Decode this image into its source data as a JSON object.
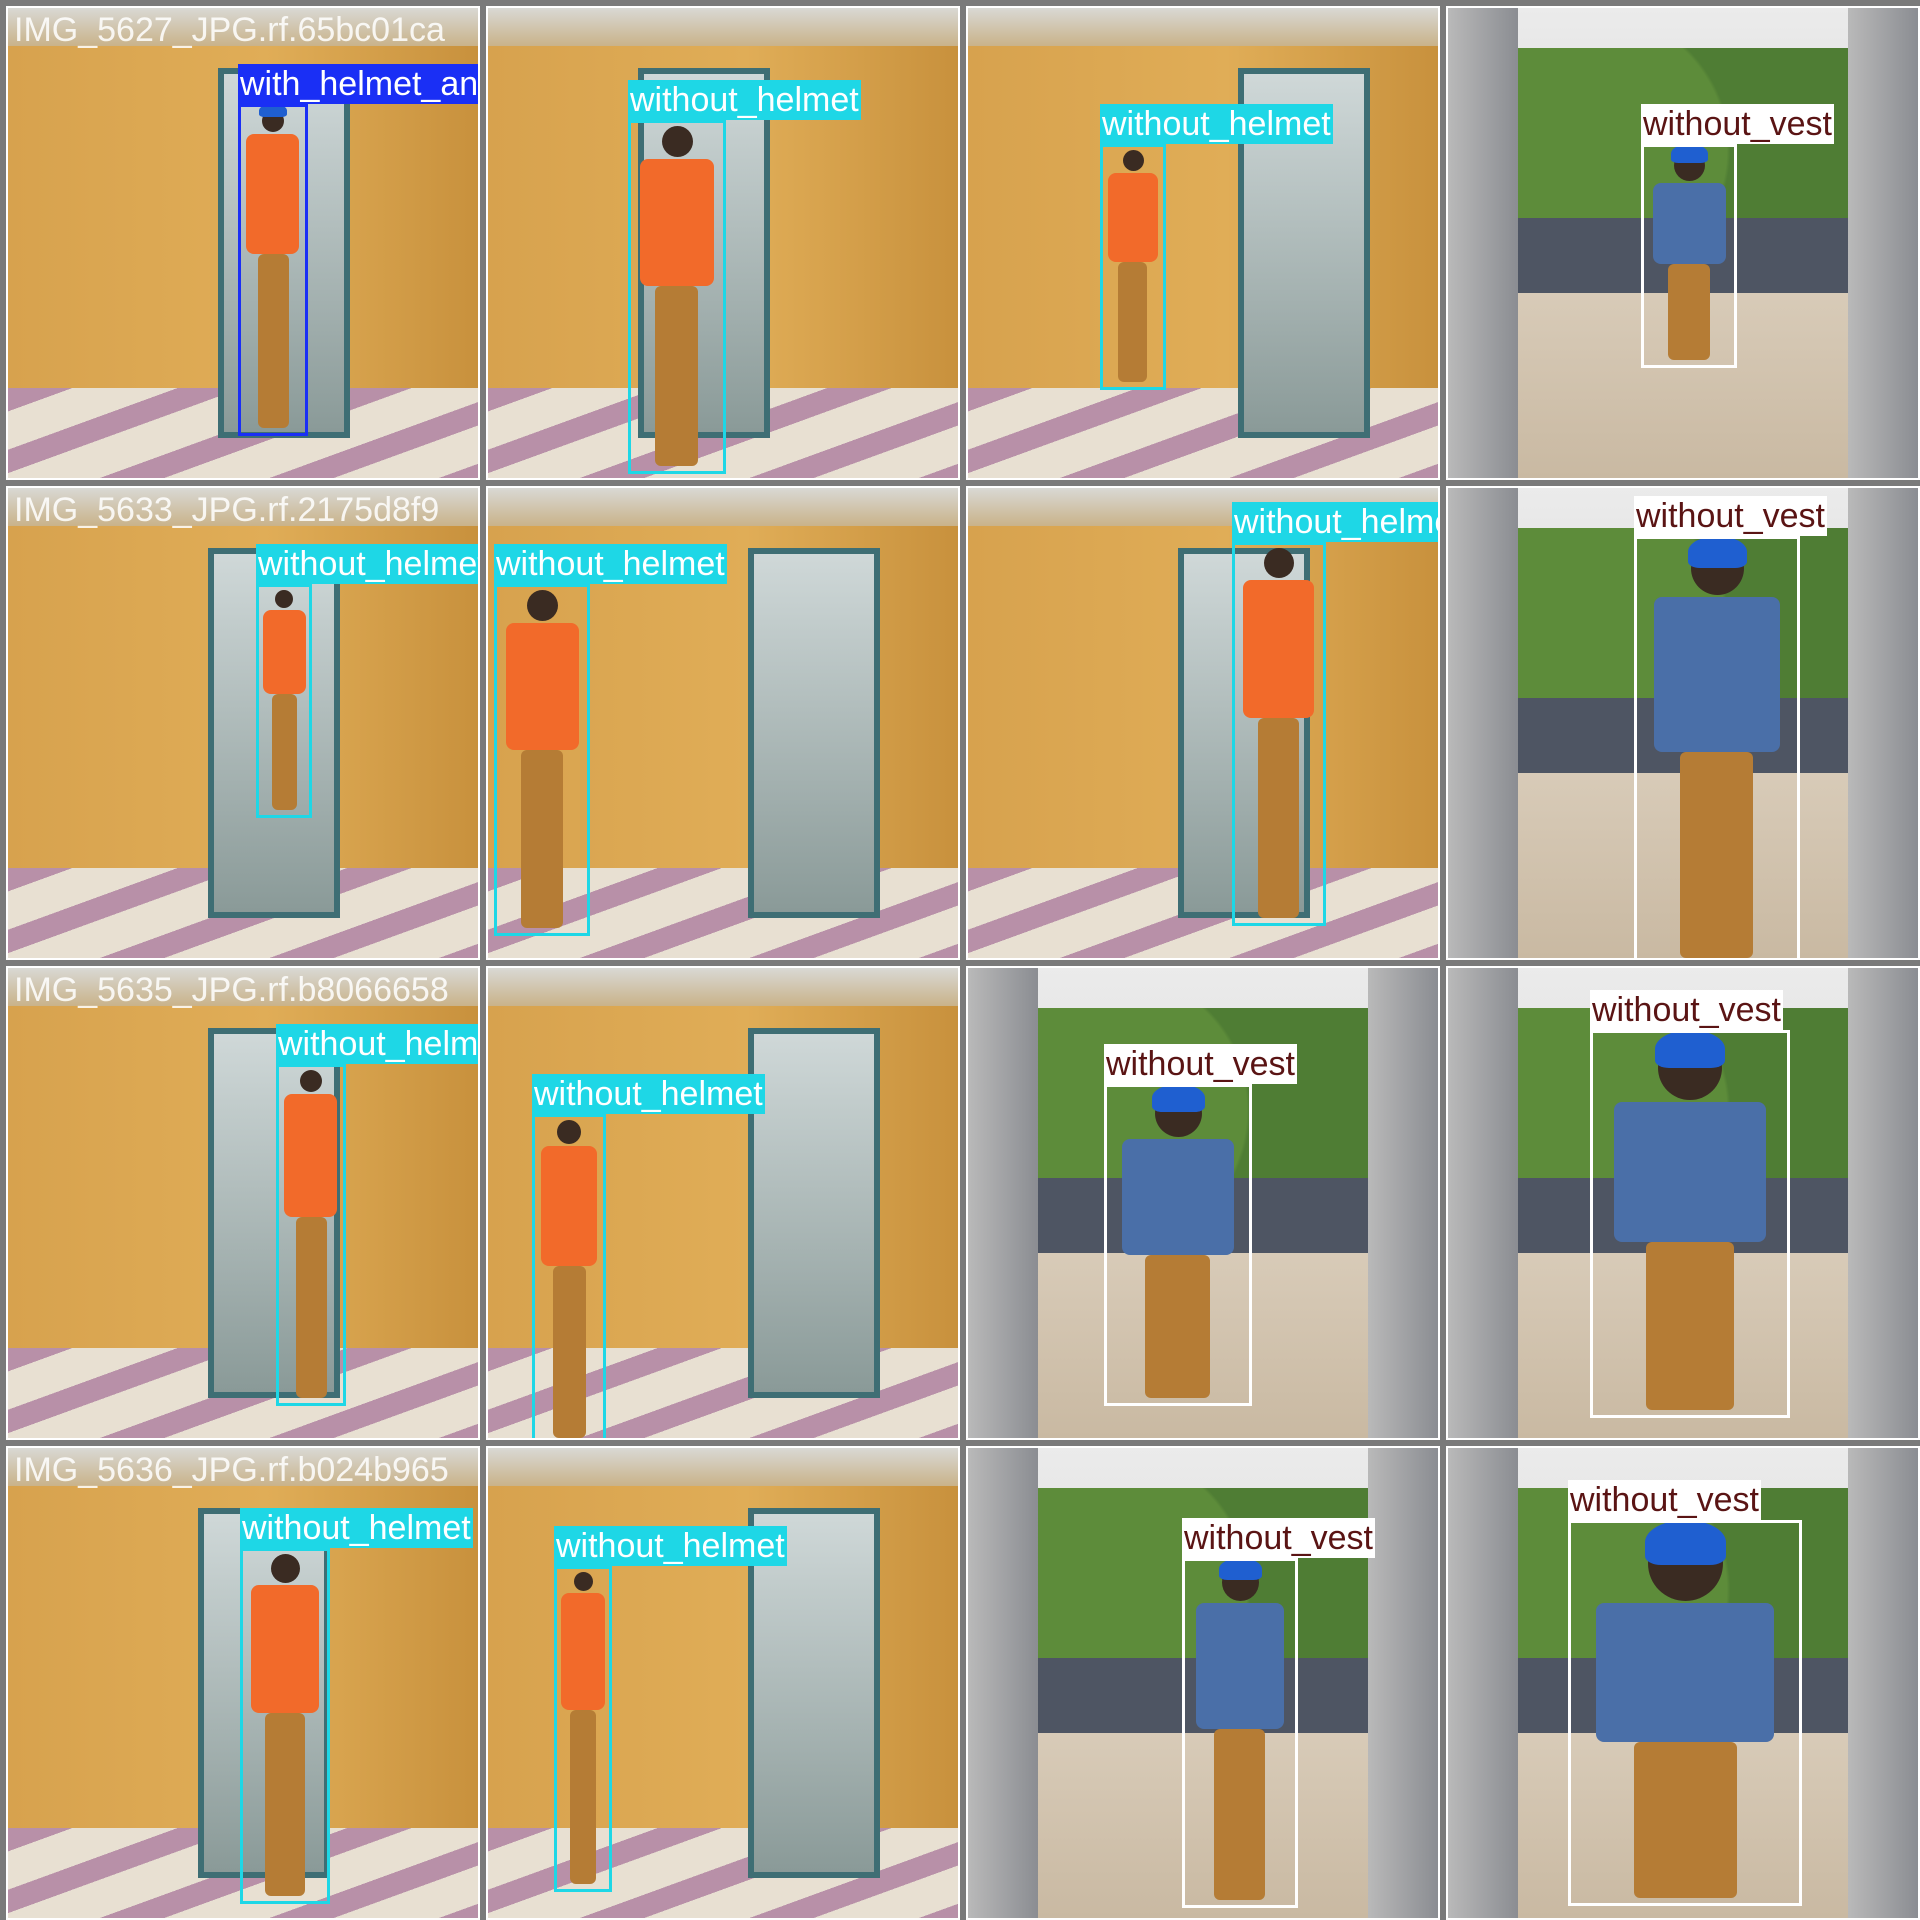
{
  "classes": {
    "with_helmet_and_vest": {
      "label": "with_helmet_and_vest",
      "color": "#1a2ff5",
      "text_color": "#ffffff"
    },
    "without_helmet": {
      "label": "without_helmet",
      "color": "#1ed7e6",
      "text_color": "#ffffff"
    },
    "without_vest": {
      "label": "without_vest",
      "color": "#ffffff",
      "text_color": "#5a1414"
    }
  },
  "tiles": [
    {
      "caption": "IMG_5627_JPG.rf.65bc01ca",
      "scene": "corridor",
      "label": "with_helmet_and_vest"
    },
    {
      "caption": "",
      "scene": "corridor",
      "label": "without_helmet"
    },
    {
      "caption": "",
      "scene": "corridor",
      "label": "without_helmet"
    },
    {
      "caption": "",
      "scene": "balcony",
      "label": "without_vest"
    },
    {
      "caption": "IMG_5633_JPG.rf.2175d8f9",
      "scene": "corridor",
      "label": "without_helmet"
    },
    {
      "caption": "",
      "scene": "corridor",
      "label": "without_helmet"
    },
    {
      "caption": "",
      "scene": "corridor",
      "label": "without_helmet"
    },
    {
      "caption": "",
      "scene": "balcony",
      "label": "without_vest"
    },
    {
      "caption": "IMG_5635_JPG.rf.b8066658",
      "scene": "corridor",
      "label": "without_helmet"
    },
    {
      "caption": "",
      "scene": "corridor",
      "label": "without_helmet"
    },
    {
      "caption": "",
      "scene": "balcony",
      "label": "without_vest"
    },
    {
      "caption": "",
      "scene": "balcony",
      "label": "without_vest"
    },
    {
      "caption": "IMG_5636_JPG.rf.b024b965",
      "scene": "corridor",
      "label": "without_helmet"
    },
    {
      "caption": "",
      "scene": "corridor",
      "label": "without_helmet"
    },
    {
      "caption": "",
      "scene": "balcony",
      "label": "without_vest"
    },
    {
      "caption": "",
      "scene": "balcony",
      "label": "without_vest"
    }
  ]
}
